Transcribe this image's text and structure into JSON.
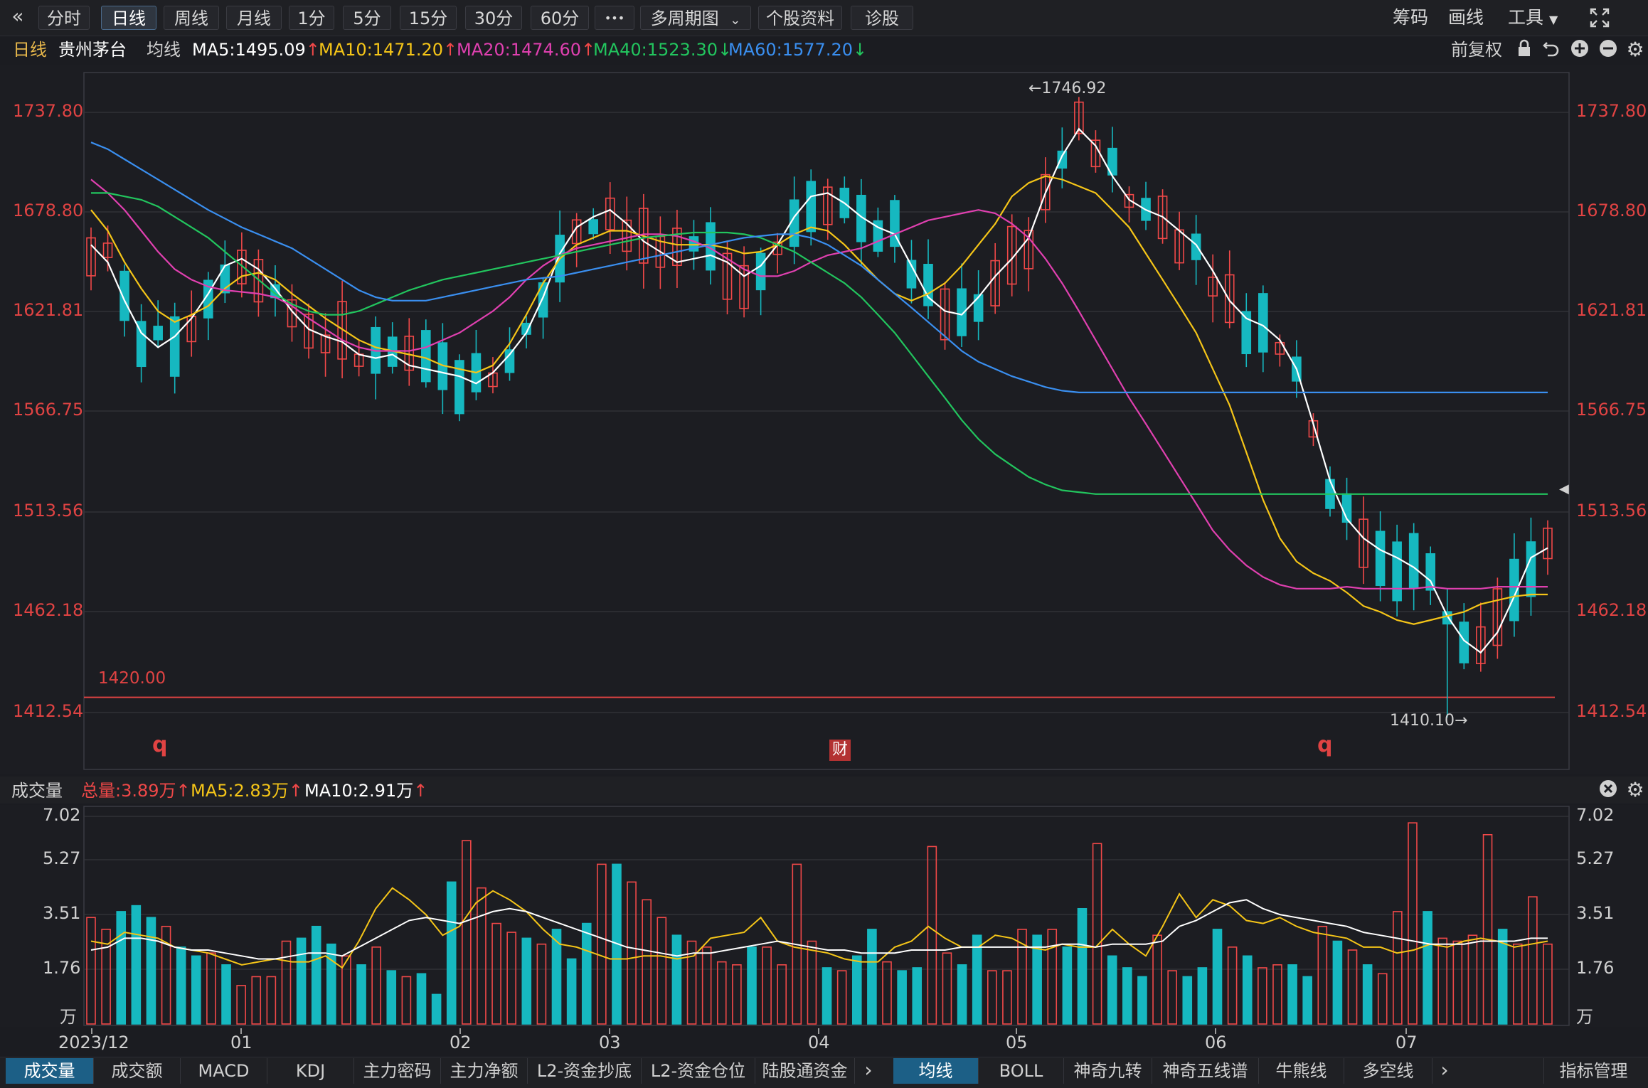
{
  "toolbar": {
    "back_icon": "«",
    "tabs": [
      "分时",
      "日线",
      "周线",
      "月线",
      "1分",
      "5分",
      "15分",
      "30分",
      "60分"
    ],
    "active_tab": "日线",
    "more_label": "•••",
    "multi_period_label": "多周期图",
    "stock_info_label": "个股资料",
    "diagnose_label": "诊股",
    "chip_label": "筹码",
    "draw_label": "画线",
    "tools_label": "工具",
    "fullscreen_icon": "fullscreen-icon"
  },
  "info": {
    "period": "日线",
    "stock_name": "贵州茅台",
    "ma_label": "均线",
    "ma5": "MA5:1495.09",
    "ma10": "MA10:1471.20",
    "ma20": "MA20:1474.60",
    "ma40": "MA40:1523.30",
    "ma60": "MA60:1577.20",
    "ma5_trend": "↑",
    "ma10_trend": "↑",
    "ma20_trend": "↑",
    "ma40_trend": "↓",
    "ma60_trend": "↓",
    "adjust_label": "前复权"
  },
  "colors": {
    "up": "#f04848",
    "down": "#16b8c0",
    "ma5": "#ffffff",
    "ma10": "#f5c518",
    "ma20": "#e040b0",
    "ma40": "#22c55e",
    "ma60": "#3a8ff0"
  },
  "price_axis": {
    "ticks": [
      "1737.80",
      "1678.80",
      "1621.81",
      "1566.75",
      "1513.56",
      "1462.18",
      "1412.54"
    ],
    "high_marker": "←1746.92",
    "low_marker": "1410.10→",
    "line_label": "1420.00",
    "q_marker": "q",
    "cai_marker": "财"
  },
  "volume": {
    "title": "成交量",
    "total": "总量:3.89万",
    "ma5": "MA5:2.83万",
    "ma10": "MA10:2.91万",
    "trend": "↑",
    "ticks": [
      "7.02",
      "5.27",
      "3.51",
      "1.76"
    ],
    "unit": "万"
  },
  "date_axis": [
    "2023/12",
    "01",
    "02",
    "03",
    "04",
    "05",
    "06",
    "07"
  ],
  "bottom_tabs_left": [
    "成交量",
    "成交额",
    "MACD",
    "KDJ",
    "主力密码",
    "主力净额",
    "L2-资金抄底",
    "L2-资金仓位",
    "陆股通资金"
  ],
  "bottom_tabs_right": [
    "均线",
    "BOLL",
    "神奇九转",
    "神奇五线谱",
    "牛熊线",
    "多空线"
  ],
  "indicator_manage": "指标管理",
  "chart_data": {
    "type": "candlestick",
    "title": "贵州茅台 日线",
    "ylim": [
      1400,
      1760
    ],
    "series": [
      {
        "name": "MA5",
        "values": [
          1660,
          1650,
          1628,
          1610,
          1602,
          1608,
          1618,
          1632,
          1648,
          1652,
          1646,
          1635,
          1622,
          1612,
          1608,
          1605,
          1598,
          1596,
          1598,
          1592,
          1590,
          1588,
          1586,
          1582,
          1588,
          1598,
          1610,
          1630,
          1655,
          1670,
          1676,
          1680,
          1672,
          1662,
          1656,
          1650,
          1652,
          1654,
          1650,
          1642,
          1648,
          1660,
          1676,
          1688,
          1690,
          1684,
          1676,
          1670,
          1666,
          1648,
          1630,
          1622,
          1620,
          1630,
          1642,
          1652,
          1664,
          1690,
          1712,
          1728,
          1718,
          1700,
          1686,
          1680,
          1676,
          1668,
          1660,
          1645,
          1628,
          1618,
          1614,
          1606,
          1590,
          1560,
          1530,
          1510,
          1500,
          1494,
          1490,
          1485,
          1478,
          1460,
          1448,
          1442,
          1452,
          1470,
          1490,
          1495
        ]
      },
      {
        "name": "MA10",
        "values": [
          1680,
          1668,
          1650,
          1635,
          1622,
          1616,
          1620,
          1625,
          1635,
          1642,
          1644,
          1640,
          1632,
          1625,
          1618,
          1612,
          1606,
          1602,
          1600,
          1598,
          1596,
          1592,
          1590,
          1588,
          1592,
          1604,
          1620,
          1638,
          1652,
          1660,
          1664,
          1668,
          1668,
          1665,
          1662,
          1660,
          1660,
          1660,
          1658,
          1655,
          1656,
          1660,
          1666,
          1670,
          1668,
          1660,
          1650,
          1640,
          1632,
          1628,
          1632,
          1638,
          1648,
          1660,
          1672,
          1688,
          1696,
          1700,
          1698,
          1694,
          1690,
          1680,
          1670,
          1655,
          1640,
          1625,
          1610,
          1590,
          1570,
          1545,
          1520,
          1500,
          1488,
          1482,
          1478,
          1472,
          1465,
          1462,
          1458,
          1456,
          1458,
          1460,
          1462,
          1466,
          1468,
          1470,
          1471,
          1471
        ]
      },
      {
        "name": "MA20",
        "values": [
          1698,
          1690,
          1680,
          1668,
          1656,
          1646,
          1640,
          1636,
          1634,
          1633,
          1632,
          1630,
          1625,
          1618,
          1612,
          1606,
          1602,
          1600,
          1600,
          1600,
          1602,
          1606,
          1610,
          1616,
          1622,
          1630,
          1640,
          1648,
          1654,
          1658,
          1660,
          1662,
          1664,
          1666,
          1666,
          1665,
          1662,
          1658,
          1652,
          1646,
          1642,
          1642,
          1645,
          1650,
          1654,
          1656,
          1658,
          1662,
          1666,
          1670,
          1674,
          1676,
          1678,
          1680,
          1678,
          1672,
          1664,
          1652,
          1638,
          1622,
          1606,
          1590,
          1574,
          1560,
          1546,
          1532,
          1518,
          1504,
          1494,
          1486,
          1480,
          1476,
          1474,
          1474,
          1474,
          1475,
          1474,
          1474,
          1474,
          1474,
          1475,
          1474,
          1474,
          1474,
          1475,
          1475,
          1475,
          1475
        ]
      },
      {
        "name": "MA40",
        "values": [
          1690,
          1690,
          1688,
          1686,
          1682,
          1676,
          1670,
          1664,
          1656,
          1648,
          1640,
          1632,
          1626,
          1622,
          1620,
          1620,
          1622,
          1626,
          1630,
          1634,
          1637,
          1640,
          1642,
          1644,
          1646,
          1648,
          1650,
          1652,
          1654,
          1656,
          1658,
          1660,
          1662,
          1664,
          1665,
          1666,
          1667,
          1667,
          1667,
          1666,
          1664,
          1660,
          1656,
          1650,
          1644,
          1638,
          1630,
          1620,
          1610,
          1598,
          1586,
          1574,
          1562,
          1552,
          1544,
          1538,
          1532,
          1528,
          1525,
          1524,
          1523,
          1523,
          1523,
          1523,
          1523,
          1523,
          1523,
          1523,
          1523,
          1523,
          1523,
          1523,
          1523,
          1523,
          1523,
          1523,
          1523,
          1523,
          1523,
          1523,
          1523,
          1523,
          1523,
          1523,
          1523,
          1523,
          1523,
          1523
        ]
      },
      {
        "name": "MA60",
        "values": [
          1720,
          1716,
          1710,
          1704,
          1698,
          1692,
          1686,
          1680,
          1675,
          1670,
          1666,
          1662,
          1658,
          1652,
          1646,
          1640,
          1634,
          1630,
          1628,
          1628,
          1628,
          1630,
          1632,
          1634,
          1636,
          1638,
          1640,
          1641,
          1642,
          1644,
          1646,
          1648,
          1650,
          1652,
          1654,
          1656,
          1658,
          1660,
          1662,
          1664,
          1665,
          1666,
          1666,
          1664,
          1660,
          1654,
          1648,
          1640,
          1632,
          1624,
          1616,
          1608,
          1600,
          1594,
          1590,
          1586,
          1583,
          1580,
          1578,
          1577,
          1577,
          1577,
          1577,
          1577,
          1577,
          1577,
          1577,
          1577,
          1577,
          1577,
          1577,
          1577,
          1577,
          1577,
          1577,
          1577,
          1577,
          1577,
          1577,
          1577,
          1577,
          1577,
          1577,
          1577,
          1577,
          1577,
          1577,
          1577
        ]
      }
    ],
    "volume_series": [
      {
        "name": "总量",
        "values": [
          3.6,
          3.2,
          3.8,
          4.0,
          3.6,
          3.3,
          2.6,
          2.3,
          2.4,
          2.0,
          1.3,
          1.6,
          1.6,
          2.8,
          2.9,
          3.3,
          2.7,
          2.3,
          2.0,
          2.6,
          1.8,
          1.6,
          1.7,
          1.0,
          4.8,
          6.2,
          4.6,
          3.4,
          3.1,
          2.9,
          2.7,
          3.2,
          2.2,
          3.4,
          5.4,
          5.4,
          4.8,
          4.2,
          3.6,
          3.0,
          2.8,
          2.6,
          2.1,
          2.0,
          2.6,
          2.6,
          2.0,
          5.4,
          2.8,
          1.9,
          1.8,
          2.3,
          3.2,
          2.1,
          1.8,
          1.9,
          6.0,
          2.4,
          2.0,
          3.0,
          1.8,
          1.8,
          3.2,
          3.0,
          3.2,
          2.6,
          3.9,
          6.1,
          2.3,
          1.9,
          1.6,
          3.0,
          1.8,
          1.6,
          1.9,
          3.2,
          2.6,
          2.3,
          1.9,
          2.0,
          2.0,
          1.6,
          3.3,
          2.8,
          2.5,
          2.0,
          1.7,
          3.8,
          6.8,
          3.8,
          2.9,
          2.8,
          3.0,
          6.4,
          3.2,
          2.7,
          4.3,
          2.7
        ]
      },
      {
        "name": "MA5",
        "values": [
          2.8,
          2.7,
          3.1,
          3.0,
          2.9,
          2.6,
          2.5,
          2.4,
          2.2,
          2.0,
          2.1,
          2.2,
          2.1,
          2.1,
          2.3,
          1.9,
          2.8,
          3.9,
          4.6,
          4.2,
          3.7,
          3.0,
          3.3,
          4.1,
          4.5,
          4.2,
          3.8,
          3.2,
          2.7,
          2.6,
          2.4,
          2.2,
          2.2,
          2.3,
          2.3,
          2.2,
          2.3,
          2.9,
          3.0,
          3.1,
          3.6,
          2.8,
          2.6,
          2.5,
          2.4,
          2.2,
          2.1,
          2.1,
          2.6,
          2.8,
          3.3,
          2.9,
          2.6,
          2.6,
          3.0,
          2.9,
          2.6,
          2.5,
          2.7,
          2.6,
          2.6,
          3.2,
          2.7,
          2.3,
          3.3,
          4.4,
          3.6,
          4.2,
          4.0,
          3.5,
          3.4,
          3.6,
          3.3,
          3.1,
          3.0,
          2.9,
          2.6,
          2.6,
          2.4,
          2.5,
          2.7,
          2.6,
          2.8,
          2.9,
          2.8,
          2.6,
          2.7,
          2.8
        ]
      },
      {
        "name": "MA10",
        "values": [
          2.5,
          2.6,
          2.9,
          2.9,
          2.8,
          2.6,
          2.5,
          2.5,
          2.4,
          2.3,
          2.2,
          2.2,
          2.3,
          2.4,
          2.4,
          2.3,
          2.6,
          2.9,
          3.2,
          3.5,
          3.6,
          3.5,
          3.4,
          3.6,
          3.8,
          3.9,
          3.8,
          3.6,
          3.4,
          3.2,
          3.0,
          2.8,
          2.6,
          2.5,
          2.4,
          2.3,
          2.4,
          2.4,
          2.5,
          2.6,
          2.7,
          2.8,
          2.7,
          2.6,
          2.5,
          2.5,
          2.4,
          2.4,
          2.4,
          2.5,
          2.5,
          2.5,
          2.6,
          2.6,
          2.6,
          2.6,
          2.6,
          2.6,
          2.7,
          2.7,
          2.6,
          2.7,
          2.7,
          2.7,
          2.8,
          3.3,
          3.5,
          3.8,
          4.1,
          4.2,
          3.9,
          3.7,
          3.6,
          3.5,
          3.4,
          3.3,
          3.1,
          3.0,
          2.9,
          2.8,
          2.7,
          2.7,
          2.7,
          2.8,
          2.8,
          2.8,
          2.9,
          2.9
        ]
      }
    ],
    "ylabel": "",
    "xlabel": "",
    "volume_ylim": [
      0,
      7.02
    ],
    "reference_line": 1420.0,
    "highest": 1746.92,
    "lowest": 1410.1,
    "x_ticks": [
      "2023/12",
      "01",
      "02",
      "03",
      "04",
      "05",
      "06",
      "07"
    ],
    "legend": "top-left",
    "grid": true
  }
}
